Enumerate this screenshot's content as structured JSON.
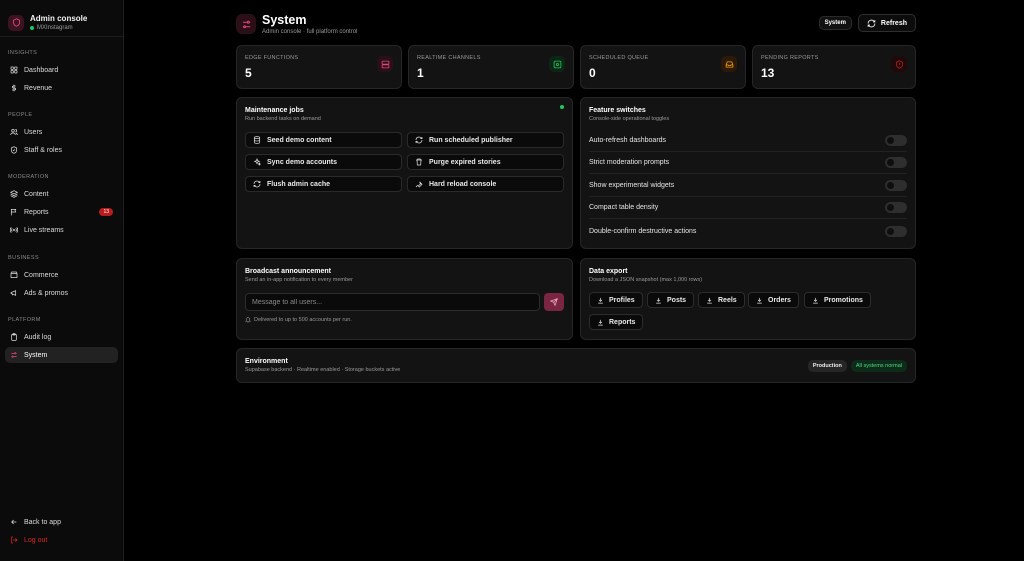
{
  "brand": {
    "title": "Admin console",
    "subtitle": "MXInstagram"
  },
  "sidebar": {
    "sections": [
      {
        "label": "INSIGHTS",
        "items": [
          {
            "label": "Dashboard",
            "icon": "grid-icon"
          },
          {
            "label": "Revenue",
            "icon": "dollar-icon"
          }
        ]
      },
      {
        "label": "PEOPLE",
        "items": [
          {
            "label": "Users",
            "icon": "users-icon"
          },
          {
            "label": "Staff & roles",
            "icon": "shield-icon"
          }
        ]
      },
      {
        "label": "MODERATION",
        "items": [
          {
            "label": "Content",
            "icon": "layers-icon"
          },
          {
            "label": "Reports",
            "icon": "flag-icon",
            "badge": "13"
          },
          {
            "label": "Live streams",
            "icon": "broadcast-icon"
          }
        ]
      },
      {
        "label": "BUSINESS",
        "items": [
          {
            "label": "Commerce",
            "icon": "store-icon"
          },
          {
            "label": "Ads & promos",
            "icon": "megaphone-icon"
          }
        ]
      },
      {
        "label": "PLATFORM",
        "items": [
          {
            "label": "Audit log",
            "icon": "clipboard-icon"
          },
          {
            "label": "System",
            "icon": "sliders-icon",
            "active": true
          }
        ]
      }
    ],
    "back_label": "Back to app",
    "logout_label": "Log out"
  },
  "header": {
    "title": "System",
    "subtitle": "Admin console · full platform control",
    "tag": "System",
    "refresh_label": "Refresh"
  },
  "stats": [
    {
      "label": "EDGE FUNCTIONS",
      "value": "5",
      "icon": "server-icon",
      "color": "#e0457b"
    },
    {
      "label": "REALTIME CHANNELS",
      "value": "1",
      "icon": "activity-icon",
      "color": "#22c55e"
    },
    {
      "label": "SCHEDULED QUEUE",
      "value": "0",
      "icon": "inbox-icon",
      "color": "#f59e0b"
    },
    {
      "label": "PENDING REPORTS",
      "value": "13",
      "icon": "alert-icon",
      "color": "#b91c1c"
    }
  ],
  "maintenance": {
    "title": "Maintenance jobs",
    "subtitle": "Run backend tasks on demand",
    "jobs": [
      {
        "label": "Seed demo content",
        "icon": "database-icon"
      },
      {
        "label": "Run scheduled publisher",
        "icon": "refresh-icon"
      },
      {
        "label": "Sync demo accounts",
        "icon": "sparkles-icon"
      },
      {
        "label": "Purge expired stories",
        "icon": "trash-icon"
      },
      {
        "label": "Flush admin cache",
        "icon": "refresh-icon"
      },
      {
        "label": "Hard reload console",
        "icon": "wrench-icon"
      }
    ]
  },
  "features": {
    "title": "Feature switches",
    "subtitle": "Console-side operational toggles",
    "switches": [
      {
        "label": "Auto-refresh dashboards",
        "on": false
      },
      {
        "label": "Strict moderation prompts",
        "on": false
      },
      {
        "label": "Show experimental widgets",
        "on": false
      },
      {
        "label": "Compact table density",
        "on": false
      },
      {
        "label": "Double-confirm destructive actions",
        "on": false
      }
    ]
  },
  "broadcast": {
    "title": "Broadcast announcement",
    "subtitle": "Send an in-app notification to every member",
    "placeholder": "Message to all users...",
    "note": "Delivered to up to 500 accounts per run."
  },
  "export": {
    "title": "Data export",
    "subtitle": "Download a JSON snapshot (max 1,000 rows)",
    "buttons": [
      "Profiles",
      "Posts",
      "Reels",
      "Orders",
      "Promotions",
      "Reports"
    ]
  },
  "environment": {
    "title": "Environment",
    "subtitle": "Supabase backend · Realtime enabled · Storage buckets active",
    "env_badge": "Production",
    "status_badge": "All systems normal"
  },
  "colors": {
    "accent": "#e0457b",
    "success": "#22c55e",
    "danger": "#dc2626"
  }
}
